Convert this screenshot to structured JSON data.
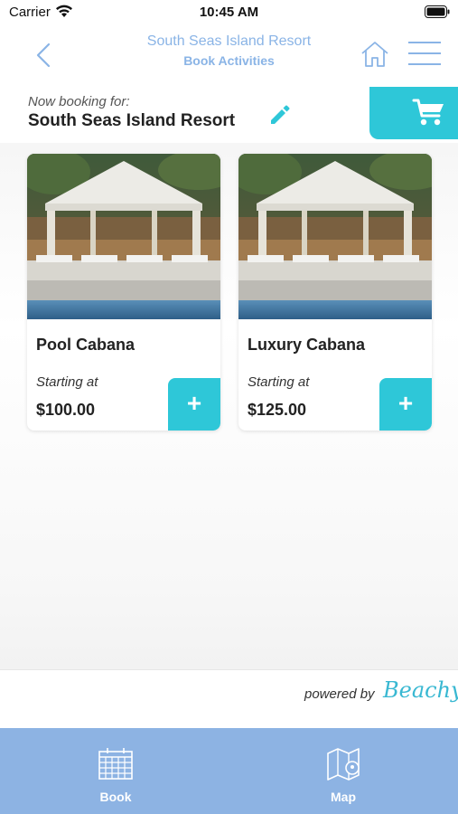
{
  "status_bar": {
    "carrier": "Carrier",
    "time": "10:45 AM"
  },
  "header": {
    "title": "South Seas Island Resort",
    "subtitle": "Book Activities"
  },
  "booking": {
    "label": "Now booking for:",
    "resort": "South Seas Island Resort"
  },
  "activities": [
    {
      "name": "Pool Cabana",
      "starting_label": "Starting at",
      "price": "$100.00",
      "add_label": "+"
    },
    {
      "name": "Luxury Cabana",
      "starting_label": "Starting at",
      "price": "$125.00",
      "add_label": "+"
    }
  ],
  "footer": {
    "powered_by": "powered by",
    "brand": "Beachy"
  },
  "tabs": [
    {
      "label": "Book",
      "icon": "calendar-icon"
    },
    {
      "label": "Map",
      "icon": "map-icon"
    }
  ],
  "colors": {
    "accent": "#2ec7d8",
    "nav_text": "#8ab4e6",
    "tab_bar": "#8db3e3"
  }
}
